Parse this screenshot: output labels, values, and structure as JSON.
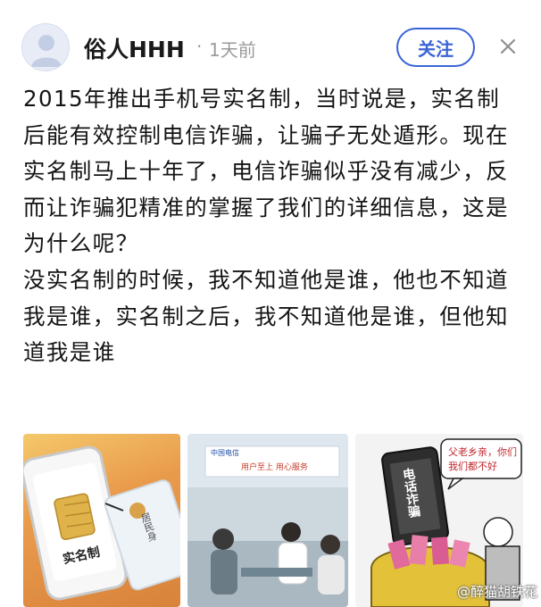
{
  "post": {
    "author": "俗人HHH",
    "separator": "·",
    "time": "1天前",
    "follow_label": "关注",
    "paragraphs": [
      "2015年推出手机号实名制，当时说是，实名制后能有效控制电信诈骗，让骗子无处遁形。现在实名制马上十年了，电信诈骗似乎没有减少，反而让诈骗犯精准的掌握了我们的详细信息，这是为什么呢？",
      "没实名制的时候，我不知道他是谁，他也不知道我是谁，实名制之后，我不知道他是谁，但他知道我是谁"
    ]
  },
  "images": {
    "img1": {
      "caption": "实名制",
      "id_card_text": "居民身"
    },
    "img2": {
      "sign_text": "用户至上 用心服务",
      "logo_text": "中国电信"
    },
    "img3": {
      "phone_text": "电话诈骗",
      "bubble_line1": "父老乡亲，你们",
      "bubble_line2": "我们都不好"
    }
  },
  "watermark": "@醉猫胡铁花",
  "colors": {
    "accent": "#3a63d6",
    "meta": "#9a9a9a"
  }
}
